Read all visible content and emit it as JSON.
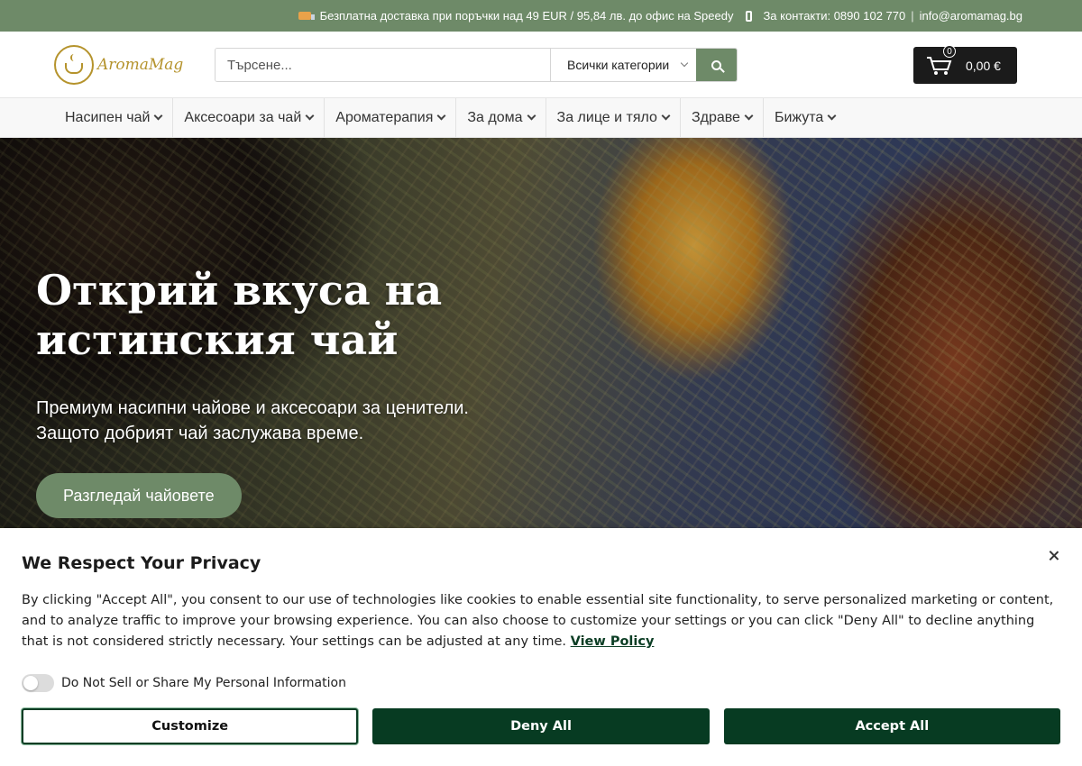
{
  "topbar": {
    "shipping": "Безплатна доставка при поръчки над 49 EUR / 95,84 лв. до офис на Speedy",
    "contacts": "За контакти: 0890 102 770",
    "divider": "|",
    "email": "info@aromamag.bg",
    "bg_color": "#6e8a68"
  },
  "header": {
    "logo_text": "AromaMag",
    "search_placeholder": "Търсене...",
    "category_select": "Всички категории",
    "cart_count": "0",
    "cart_total": "0,00 €"
  },
  "nav": {
    "items": [
      {
        "label": "Насипен чай"
      },
      {
        "label": "Аксесоари за чай"
      },
      {
        "label": "Ароматерапия"
      },
      {
        "label": "За дома"
      },
      {
        "label": "За лице и тяло"
      },
      {
        "label": "Здраве"
      },
      {
        "label": "Бижута"
      }
    ]
  },
  "hero": {
    "title": "Открий вкуса на истинския чай",
    "subtitle_line1": "Премиум насипни чайове и аксесоари за ценители.",
    "subtitle_line2": "Защото добрият чай заслужава време.",
    "cta": "Разгледай чайовете"
  },
  "cookie": {
    "title": "We Respect Your Privacy",
    "body": "By clicking \"Accept All\", you consent to our use of technologies like cookies to enable essential site functionality, to serve personalized marketing or content, and to analyze traffic to improve your browsing experience. You can also choose to customize your settings or you can click \"Deny All\" to decline anything that is not considered strictly necessary. Your settings can be adjusted at any time.",
    "policy_link": "View Policy",
    "toggle_label": "Do Not Sell or Share My Personal Information",
    "customize": "Customize",
    "deny": "Deny All",
    "accept": "Accept All",
    "accent_color": "#073b22"
  }
}
